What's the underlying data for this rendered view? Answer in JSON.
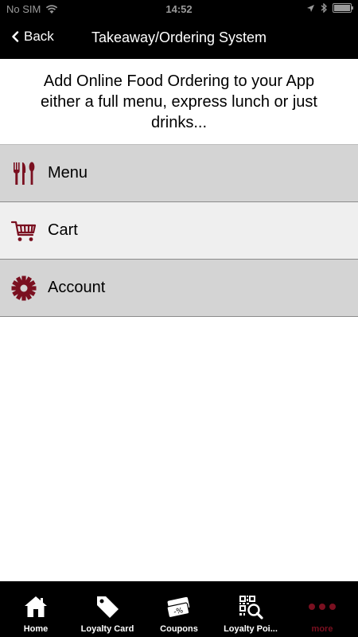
{
  "status_bar": {
    "carrier": "No SIM",
    "time": "14:52"
  },
  "nav": {
    "back_label": "Back",
    "title": "Takeaway/Ordering System"
  },
  "intro_text": "Add Online Food Ordering to your App either a full menu, express lunch or just drinks...",
  "menu_items": [
    {
      "label": "Menu",
      "icon": "cutlery-icon"
    },
    {
      "label": "Cart",
      "icon": "cart-icon"
    },
    {
      "label": "Account",
      "icon": "gear-icon"
    }
  ],
  "tabs": [
    {
      "label": "Home",
      "icon": "home-icon"
    },
    {
      "label": "Loyalty Card",
      "icon": "tag-icon"
    },
    {
      "label": "Coupons",
      "icon": "coupon-icon"
    },
    {
      "label": "Loyalty Poi...",
      "icon": "qr-search-icon"
    },
    {
      "label": "more",
      "icon": "more-dots-icon"
    }
  ],
  "colors": {
    "accent": "#7a1020",
    "bar_bg": "#000000",
    "row_dark": "#d4d4d4",
    "row_light": "#efefef"
  }
}
